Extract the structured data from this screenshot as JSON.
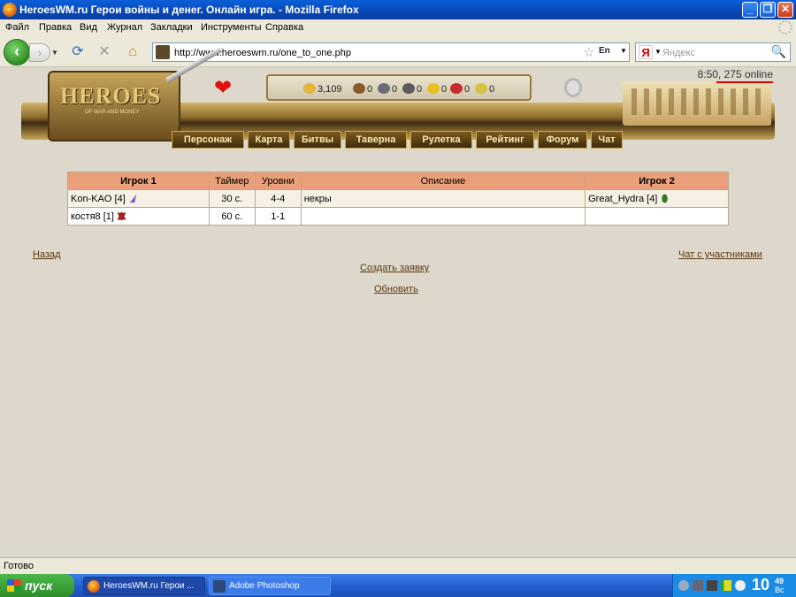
{
  "window": {
    "title": "HeroesWM.ru Герои войны и денег. Онлайн игра. - Mozilla Firefox",
    "minimize": "_",
    "restore": "❐",
    "close": "✕"
  },
  "menubar": {
    "items": [
      "Файл",
      "Правка",
      "Вид",
      "Журнал",
      "Закладки",
      "Инструменты",
      "Справка"
    ]
  },
  "toolbar": {
    "back_icon": "back-arrow-icon",
    "forward_icon": "forward-arrow-icon",
    "url": "http://www.heroeswm.ru/one_to_one.php",
    "lang_badge": "En",
    "search_engine": "Я",
    "search_placeholder": "Яндекс"
  },
  "game": {
    "logo_text": "HEROES",
    "logo_sub": "OF WAR AND MONEY",
    "time": "8:50,",
    "online": "275 online",
    "resources": [
      {
        "name": "gold",
        "value": "3,109",
        "color": "#e5b43a"
      },
      {
        "name": "wood",
        "value": "0",
        "color": "#8a5a2b"
      },
      {
        "name": "ore",
        "value": "0",
        "color": "#6a6a7a"
      },
      {
        "name": "mercury",
        "value": "0",
        "color": "#5a5a5a"
      },
      {
        "name": "sulfur",
        "value": "0",
        "color": "#e5c020"
      },
      {
        "name": "crystals",
        "value": "0",
        "color": "#c82a2a"
      },
      {
        "name": "gems",
        "value": "0",
        "color": "#d8c040"
      }
    ],
    "nav": [
      "Персонаж",
      "Карта",
      "Битвы",
      "Таверна",
      "Рулетка",
      "Рейтинг",
      "Форум",
      "Чат"
    ]
  },
  "table": {
    "headers": {
      "player1": "Игрок 1",
      "timer": "Таймер",
      "levels": "Уровни",
      "description": "Описание",
      "player2": "Игрок 2"
    },
    "rows": [
      {
        "player1": "Kon-KAO [4]",
        "faction1": "mage-faction-icon",
        "timer": "30 с.",
        "levels": "4-4",
        "description": "некры",
        "player2": "Great_Hydra [4]",
        "faction2": "sylvan-faction-icon"
      },
      {
        "player1": "костя8 [1]",
        "faction1": "inferno-faction-icon",
        "timer": "60 с.",
        "levels": "1-1",
        "description": "",
        "player2": "",
        "faction2": ""
      }
    ]
  },
  "links": {
    "back": "Назад",
    "chat": "Чат с участниками",
    "create": "Создать заявку",
    "refresh": "Обновить"
  },
  "statusbar": {
    "text": "Готово"
  },
  "taskbar": {
    "start": "пуск",
    "tasks": [
      {
        "label": "HeroesWM.ru Герои ...",
        "active": true
      },
      {
        "label": "Adobe Photoshop",
        "active": false
      }
    ],
    "clock_hour": "10",
    "clock_min": "49",
    "clock_day": "Вс"
  }
}
